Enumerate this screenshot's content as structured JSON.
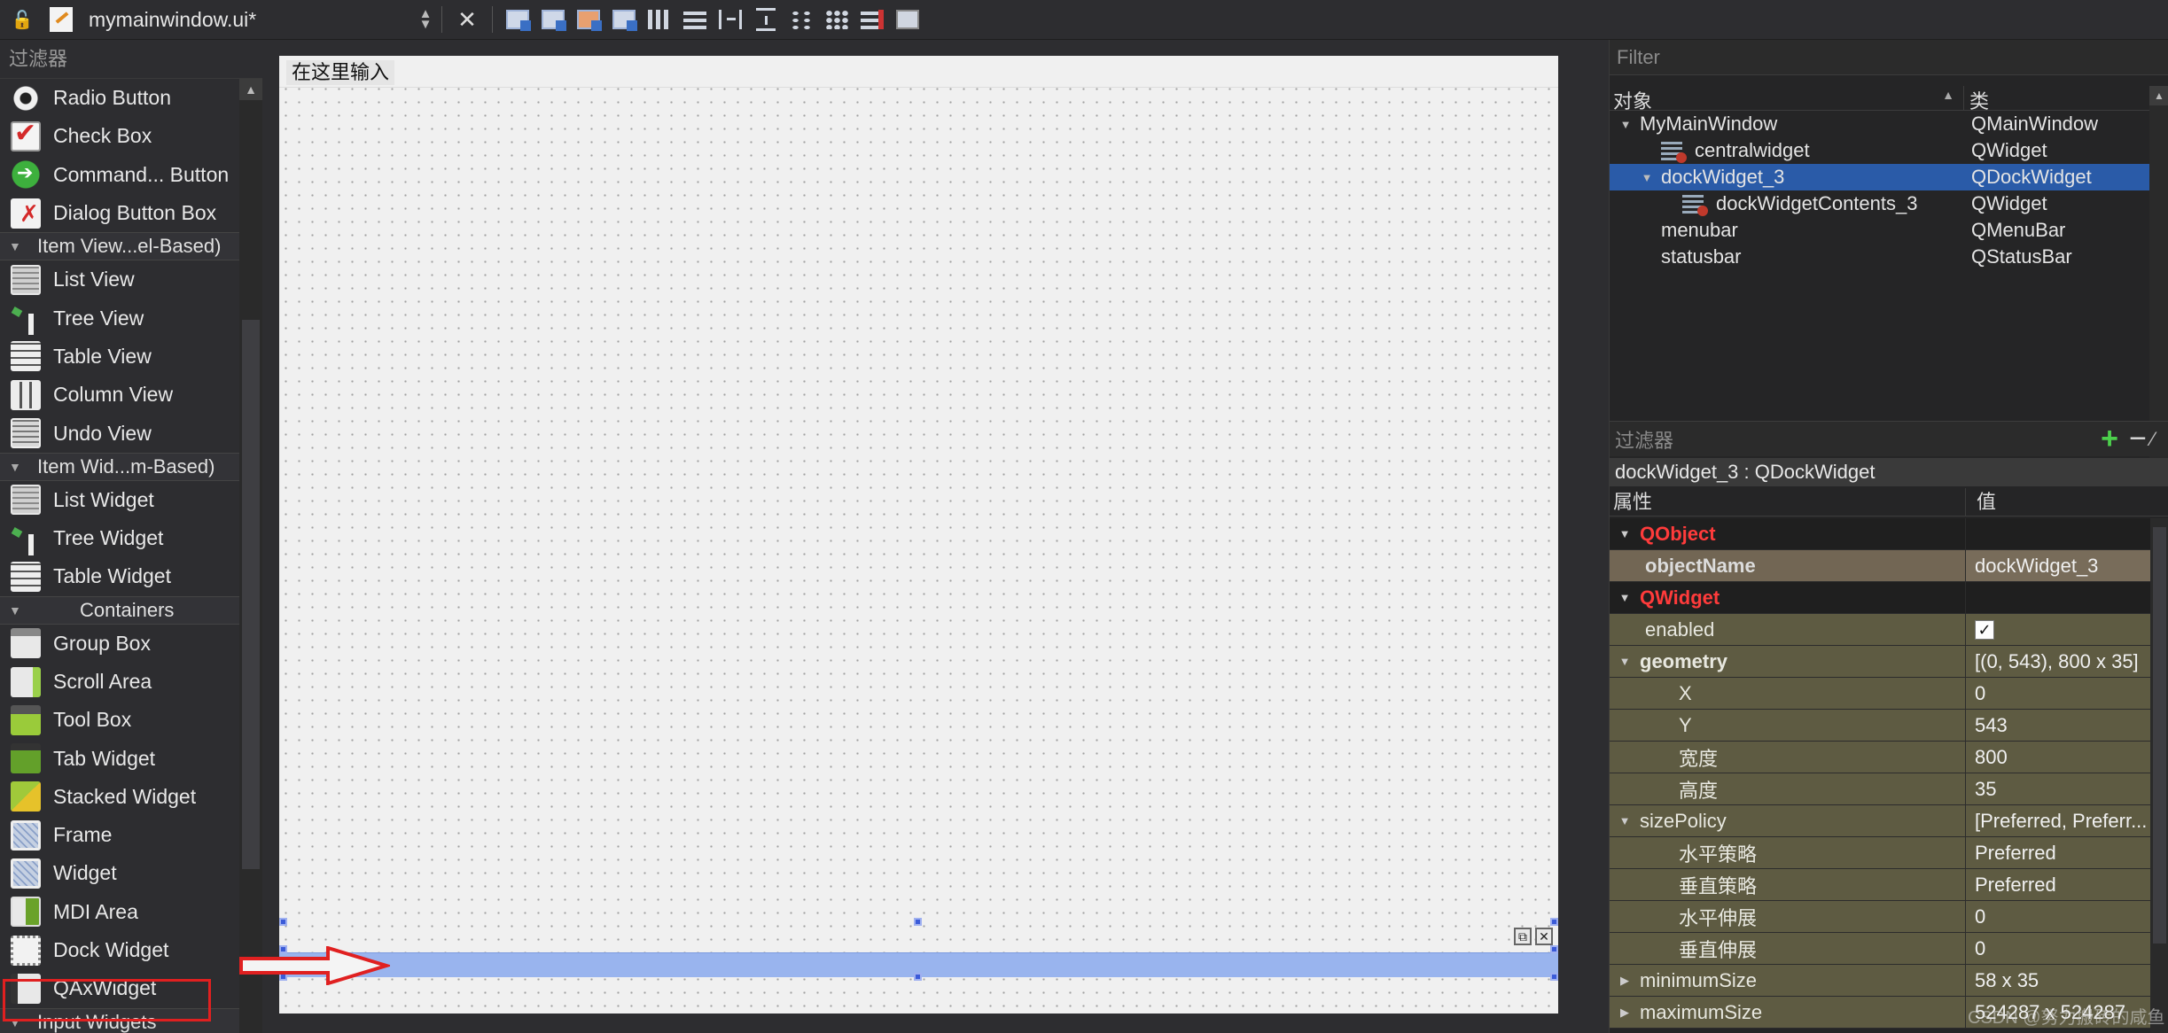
{
  "toolbar": {
    "filename": "mymainwindow.ui*",
    "icons": [
      "lock-icon",
      "file-icon",
      "close-icon",
      "edit-widgets-icon",
      "edit-signals-icon",
      "edit-buddies-icon",
      "edit-tab-order-icon",
      "layout-horizontal-icon",
      "layout-vertical-icon",
      "splitter-horizontal-icon",
      "splitter-vertical-icon",
      "layout-form-icon",
      "layout-grid-icon",
      "break-layout-icon",
      "adjust-size-icon"
    ]
  },
  "widget_box": {
    "filter_label": "过滤器",
    "items": [
      {
        "type": "item",
        "label": "Radio Button",
        "icon": "radio-button"
      },
      {
        "type": "item",
        "label": "Check Box",
        "icon": "check-box"
      },
      {
        "type": "item",
        "label": "Command... Button",
        "icon": "command-link-button"
      },
      {
        "type": "item",
        "label": "Dialog Button Box",
        "icon": "dialog-button-box"
      },
      {
        "type": "cat",
        "label": "Item View...el-Based)"
      },
      {
        "type": "item",
        "label": "List View",
        "icon": "list-view"
      },
      {
        "type": "item",
        "label": "Tree View",
        "icon": "tree-view"
      },
      {
        "type": "item",
        "label": "Table View",
        "icon": "table-view"
      },
      {
        "type": "item",
        "label": "Column View",
        "icon": "column-view"
      },
      {
        "type": "item",
        "label": "Undo View",
        "icon": "undo-view"
      },
      {
        "type": "cat",
        "label": "Item Wid...m-Based)"
      },
      {
        "type": "item",
        "label": "List Widget",
        "icon": "list-widget"
      },
      {
        "type": "item",
        "label": "Tree Widget",
        "icon": "tree-widget"
      },
      {
        "type": "item",
        "label": "Table Widget",
        "icon": "table-widget"
      },
      {
        "type": "cat",
        "label": "Containers",
        "center": true
      },
      {
        "type": "item",
        "label": "Group Box",
        "icon": "group-box"
      },
      {
        "type": "item",
        "label": "Scroll Area",
        "icon": "scroll-area"
      },
      {
        "type": "item",
        "label": "Tool Box",
        "icon": "tool-box"
      },
      {
        "type": "item",
        "label": "Tab Widget",
        "icon": "tab-widget"
      },
      {
        "type": "item",
        "label": "Stacked Widget",
        "icon": "stacked-widget"
      },
      {
        "type": "item",
        "label": "Frame",
        "icon": "frame"
      },
      {
        "type": "item",
        "label": "Widget",
        "icon": "widget"
      },
      {
        "type": "item",
        "label": "MDI Area",
        "icon": "mdi-area"
      },
      {
        "type": "item",
        "label": "Dock Widget",
        "icon": "dock-widget"
      },
      {
        "type": "item",
        "label": "QAxWidget",
        "icon": "qax-widget"
      },
      {
        "type": "cat",
        "label": "Input Widgets"
      }
    ]
  },
  "form": {
    "menu_placeholder": "在这里输入"
  },
  "object_inspector": {
    "filter_placeholder": "Filter",
    "col_object": "对象",
    "col_class": "类",
    "rows": [
      {
        "name": "MyMainWindow",
        "class": "QMainWindow",
        "depth": 0,
        "expanded": true,
        "icon": false,
        "selected": false
      },
      {
        "name": "centralwidget",
        "class": "QWidget",
        "depth": 1,
        "expanded": null,
        "icon": true,
        "selected": false
      },
      {
        "name": "dockWidget_3",
        "class": "QDockWidget",
        "depth": 1,
        "expanded": true,
        "icon": false,
        "selected": true
      },
      {
        "name": "dockWidgetContents_3",
        "class": "QWidget",
        "depth": 2,
        "expanded": null,
        "icon": true,
        "selected": false
      },
      {
        "name": "menubar",
        "class": "QMenuBar",
        "depth": 1,
        "expanded": null,
        "icon": false,
        "selected": false
      },
      {
        "name": "statusbar",
        "class": "QStatusBar",
        "depth": 1,
        "expanded": null,
        "icon": false,
        "selected": false
      }
    ]
  },
  "property_editor": {
    "filter_placeholder": "过滤器",
    "object_title": "dockWidget_3 : QDockWidget",
    "col_property": "属性",
    "col_value": "值",
    "rows": [
      {
        "kind": "group",
        "name": "QObject",
        "value": "",
        "tri": "▼"
      },
      {
        "kind": "brown",
        "name": "objectName",
        "value": "dockWidget_3",
        "bold": true,
        "indent": 1
      },
      {
        "kind": "group",
        "name": "QWidget",
        "value": "",
        "tri": "▼"
      },
      {
        "kind": "olive",
        "name": "enabled",
        "value": "",
        "check": true,
        "indent": 1
      },
      {
        "kind": "olive",
        "name": "geometry",
        "value": "[(0, 543), 800 x 35]",
        "bold": true,
        "tri": "▼"
      },
      {
        "kind": "olive",
        "name": "X",
        "value": "0",
        "indent": 2
      },
      {
        "kind": "olive",
        "name": "Y",
        "value": "543",
        "indent": 2
      },
      {
        "kind": "olive",
        "name": "宽度",
        "value": "800",
        "indent": 2
      },
      {
        "kind": "olive",
        "name": "高度",
        "value": "35",
        "indent": 2
      },
      {
        "kind": "olive",
        "name": "sizePolicy",
        "value": "[Preferred, Preferr...",
        "tri": "▼"
      },
      {
        "kind": "olive",
        "name": "水平策略",
        "value": "Preferred",
        "indent": 2
      },
      {
        "kind": "olive",
        "name": "垂直策略",
        "value": "Preferred",
        "indent": 2
      },
      {
        "kind": "olive",
        "name": "水平伸展",
        "value": "0",
        "indent": 2
      },
      {
        "kind": "olive",
        "name": "垂直伸展",
        "value": "0",
        "indent": 2
      },
      {
        "kind": "olive",
        "name": "minimumSize",
        "value": "58 x 35",
        "tri": "▶"
      },
      {
        "kind": "olive",
        "name": "maximumSize",
        "value": "524287 x 524287",
        "tri": "▶"
      }
    ]
  },
  "watermark": "CSDN @努力搬砖的咸鱼"
}
